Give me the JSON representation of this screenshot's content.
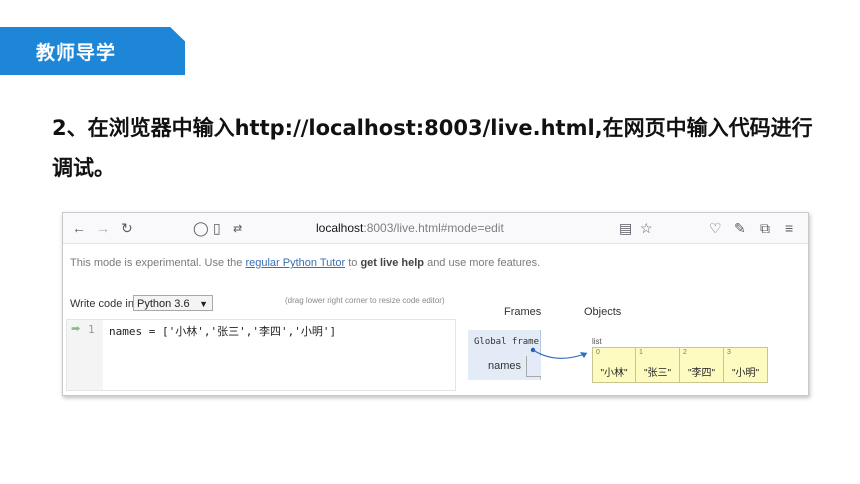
{
  "slide": {
    "tag": "教师导学",
    "heading": "2、在浏览器中输入http://localhost:8003/live.html,在网页中输入代码进行调试。"
  },
  "browser": {
    "url_host": "localhost",
    "url_rest": ":8003/live.html#mode=edit",
    "icons": [
      "back-arrow-icon",
      "forward-arrow-icon",
      "reload-icon",
      "shield-icon",
      "page-icon",
      "permissions-icon",
      "reader-view-icon",
      "star-icon",
      "pocket-icon",
      "wrench-icon",
      "extensions-icon",
      "menu-icon"
    ]
  },
  "page": {
    "notice_prefix": "This mode is experimental. Use the ",
    "notice_link": "regular Python Tutor",
    "notice_mid": " to ",
    "notice_bold": "get live help",
    "notice_suffix": " and use more features.",
    "write_label": "Write code in",
    "language": "Python 3.6",
    "drag_hint": "(drag lower right corner to resize code editor)",
    "line_number": "1",
    "code": "names = ['小林','张三','李四','小明']",
    "tabs": {
      "frames": "Frames",
      "objects": "Objects"
    },
    "frame": {
      "title": "Global frame",
      "variable": "names"
    },
    "list_label": "list",
    "list": [
      {
        "index": "0",
        "value": "\"小林\""
      },
      {
        "index": "1",
        "value": "\"张三\""
      },
      {
        "index": "2",
        "value": "\"李四\""
      },
      {
        "index": "3",
        "value": "\"小明\""
      }
    ]
  }
}
